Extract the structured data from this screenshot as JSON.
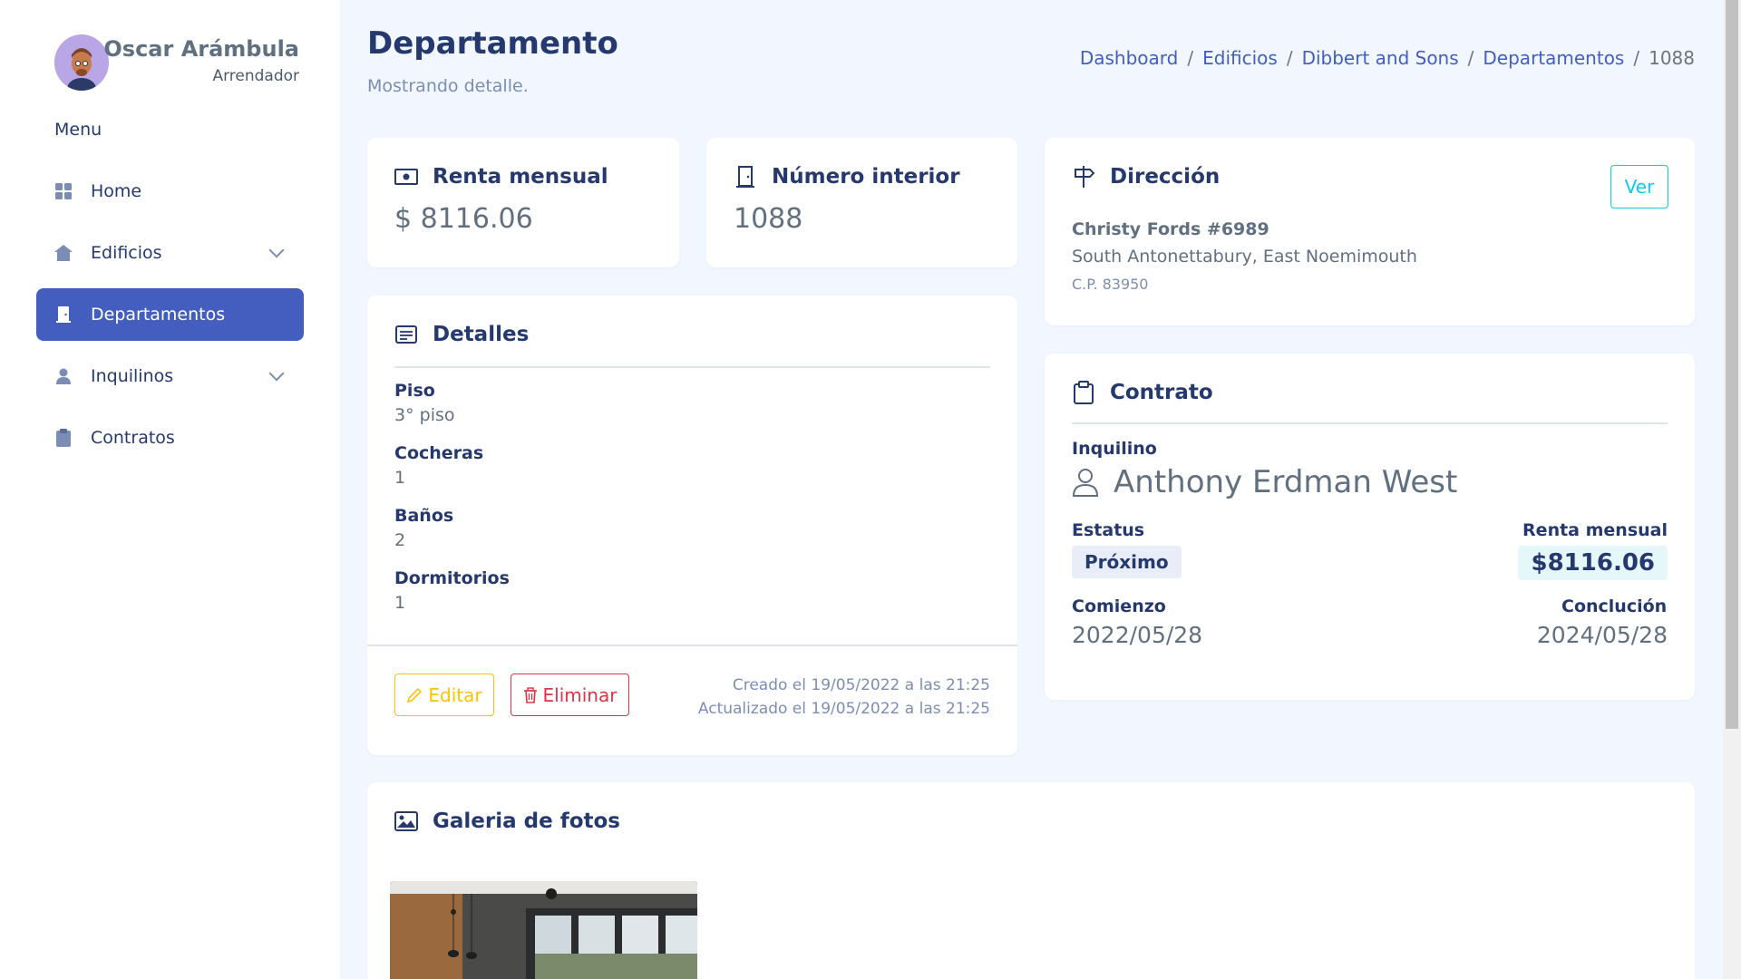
{
  "profile": {
    "name": "Oscar Arámbula",
    "role": "Arrendador"
  },
  "sidebar": {
    "menu_title": "Menu",
    "items": [
      {
        "label": "Home",
        "icon": "grid-icon",
        "active": false,
        "has_submenu": false
      },
      {
        "label": "Edificios",
        "icon": "building-icon",
        "active": false,
        "has_submenu": true
      },
      {
        "label": "Departamentos",
        "icon": "door-icon",
        "active": true,
        "has_submenu": false
      },
      {
        "label": "Inquilinos",
        "icon": "person-icon",
        "active": false,
        "has_submenu": true
      },
      {
        "label": "Contratos",
        "icon": "clipboard-icon",
        "active": false,
        "has_submenu": false
      }
    ]
  },
  "header": {
    "title": "Departamento",
    "subtitle": "Mostrando detalle."
  },
  "breadcrumb": {
    "items": [
      "Dashboard",
      "Edificios",
      "Dibbert and Sons",
      "Departamentos"
    ],
    "current": "1088"
  },
  "rent_card": {
    "title": "Renta mensual",
    "value": "$ 8116.06",
    "icon": "cash-icon"
  },
  "interior_card": {
    "title": "Número interior",
    "value": "1088",
    "icon": "door-icon"
  },
  "address_card": {
    "title": "Dirección",
    "icon": "signpost-icon",
    "button": "Ver",
    "line1": "Christy Fords #6989",
    "line2": "South Antonettabury, East Noemimouth",
    "cp": "C.P. 83950"
  },
  "details_card": {
    "title": "Detalles",
    "icon": "card-text-icon",
    "fields": [
      {
        "label": "Piso",
        "value": "3° piso"
      },
      {
        "label": "Cocheras",
        "value": "1"
      },
      {
        "label": "Baños",
        "value": "2"
      },
      {
        "label": "Dormitorios",
        "value": "1"
      }
    ],
    "edit_button": "Editar",
    "delete_button": "Eliminar",
    "created": "Creado el 19/05/2022 a las 21:25",
    "updated": "Actualizado el 19/05/2022 a las 21:25"
  },
  "contract_card": {
    "title": "Contrato",
    "icon": "clipboard-icon",
    "tenant_label": "Inquilino",
    "tenant_name": "Anthony Erdman West",
    "status_label": "Estatus",
    "status_value": "Próximo",
    "rent_label": "Renta mensual",
    "rent_value": "$8116.06",
    "start_label": "Comienzo",
    "start_value": "2022/05/28",
    "end_label": "Conclución",
    "end_value": "2024/05/28"
  },
  "gallery_card": {
    "title": "Galeria de fotos",
    "icon": "image-icon"
  },
  "colors": {
    "primary": "#435ebe",
    "warning": "#ffc107",
    "danger": "#dc3545",
    "info": "#0dcaf0",
    "background": "#f2f7ff"
  }
}
